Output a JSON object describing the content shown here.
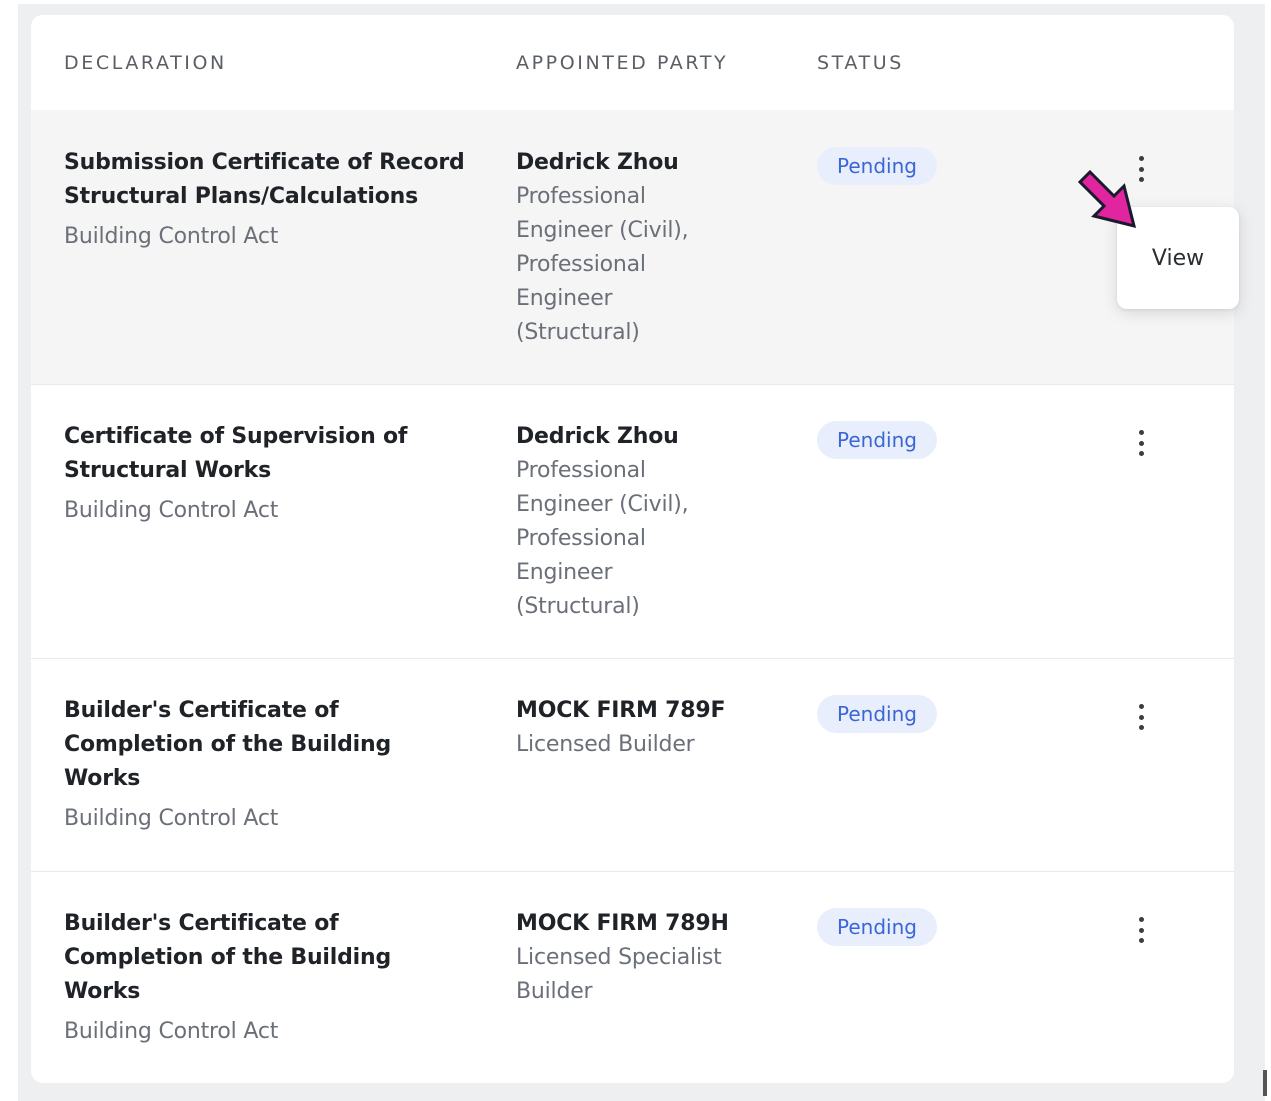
{
  "table": {
    "headers": {
      "declaration": "DECLARATION",
      "appointed_party": "APPOINTED PARTY",
      "status": "STATUS"
    },
    "rows": [
      {
        "title_lines": [
          "Submission Certificate of Record",
          "Structural Plans/Calculations"
        ],
        "act": "Building Control Act",
        "party_name": "Dedrick Zhou",
        "party_role_lines": [
          "Professional",
          "Engineer (Civil),",
          "Professional",
          "Engineer",
          "(Structural)"
        ],
        "status": "Pending"
      },
      {
        "title_lines": [
          "Certificate of Supervision of",
          "Structural Works"
        ],
        "act": "Building Control Act",
        "party_name": "Dedrick Zhou",
        "party_role_lines": [
          "Professional",
          "Engineer (Civil),",
          "Professional",
          "Engineer",
          "(Structural)"
        ],
        "status": "Pending"
      },
      {
        "title_lines": [
          "Builder's Certificate of",
          "Completion of the Building",
          "Works"
        ],
        "act": "Building Control Act",
        "party_name": "MOCK FIRM 789F",
        "party_role_lines": [
          "Licensed Builder"
        ],
        "status": "Pending"
      },
      {
        "title_lines": [
          "Builder's Certificate of",
          "Completion of the Building",
          "Works"
        ],
        "act": "Building Control Act",
        "party_name": "MOCK FIRM 789H",
        "party_role_lines": [
          "Licensed Specialist",
          "Builder"
        ],
        "status": "Pending"
      }
    ]
  },
  "row_menu": {
    "items": [
      "View"
    ]
  },
  "colors": {
    "status_badge_bg": "#e8eefb",
    "status_badge_text": "#3b66d6",
    "pointer_arrow": "#e0259f",
    "highlight_row": "#f5f5f6"
  },
  "icons": {
    "row_menu": "more-vertical-icon",
    "annotation": "pointer-arrow-icon"
  }
}
